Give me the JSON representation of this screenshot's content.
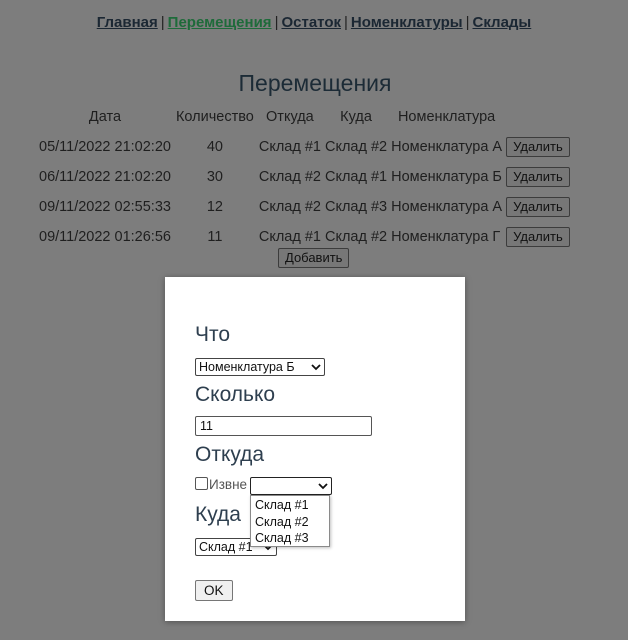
{
  "nav": {
    "items": [
      {
        "label": "Главная"
      },
      {
        "label": "Перемещения"
      },
      {
        "label": "Остаток"
      },
      {
        "label": "Номенклатуры"
      },
      {
        "label": "Склады"
      }
    ],
    "separator": "|"
  },
  "page": {
    "title": "Перемещения"
  },
  "table": {
    "headers": [
      "Дата",
      "Количество",
      "Откуда",
      "Куда",
      "Номенклатура"
    ],
    "rows": [
      {
        "date": "05/11/2022 21:02:20",
        "qty": "40",
        "from": "Склад #1",
        "to": "Склад #2",
        "item": "Номенклатура А",
        "action": "Удалить"
      },
      {
        "date": "06/11/2022 21:02:20",
        "qty": "30",
        "from": "Склад #2",
        "to": "Склад #1",
        "item": "Номенклатура Б",
        "action": "Удалить"
      },
      {
        "date": "09/11/2022 02:55:33",
        "qty": "12",
        "from": "Склад #2",
        "to": "Склад #3",
        "item": "Номенклатура А",
        "action": "Удалить"
      },
      {
        "date": "09/11/2022 01:26:56",
        "qty": "11",
        "from": "Склад #1",
        "to": "Склад #2",
        "item": "Номенклатура Г",
        "action": "Удалить"
      }
    ],
    "add_label": "Добавить"
  },
  "modal": {
    "what_label": "Что",
    "what_value": "Номенклатура Б",
    "howmany_label": "Сколько",
    "howmany_value": "11",
    "from_label": "Откуда",
    "external_label": "Извне",
    "from_value": "",
    "from_options": [
      "Склад #1",
      "Склад #2",
      "Склад #3"
    ],
    "to_label": "Куда",
    "to_value": "Склад #1",
    "ok_label": "OK"
  }
}
